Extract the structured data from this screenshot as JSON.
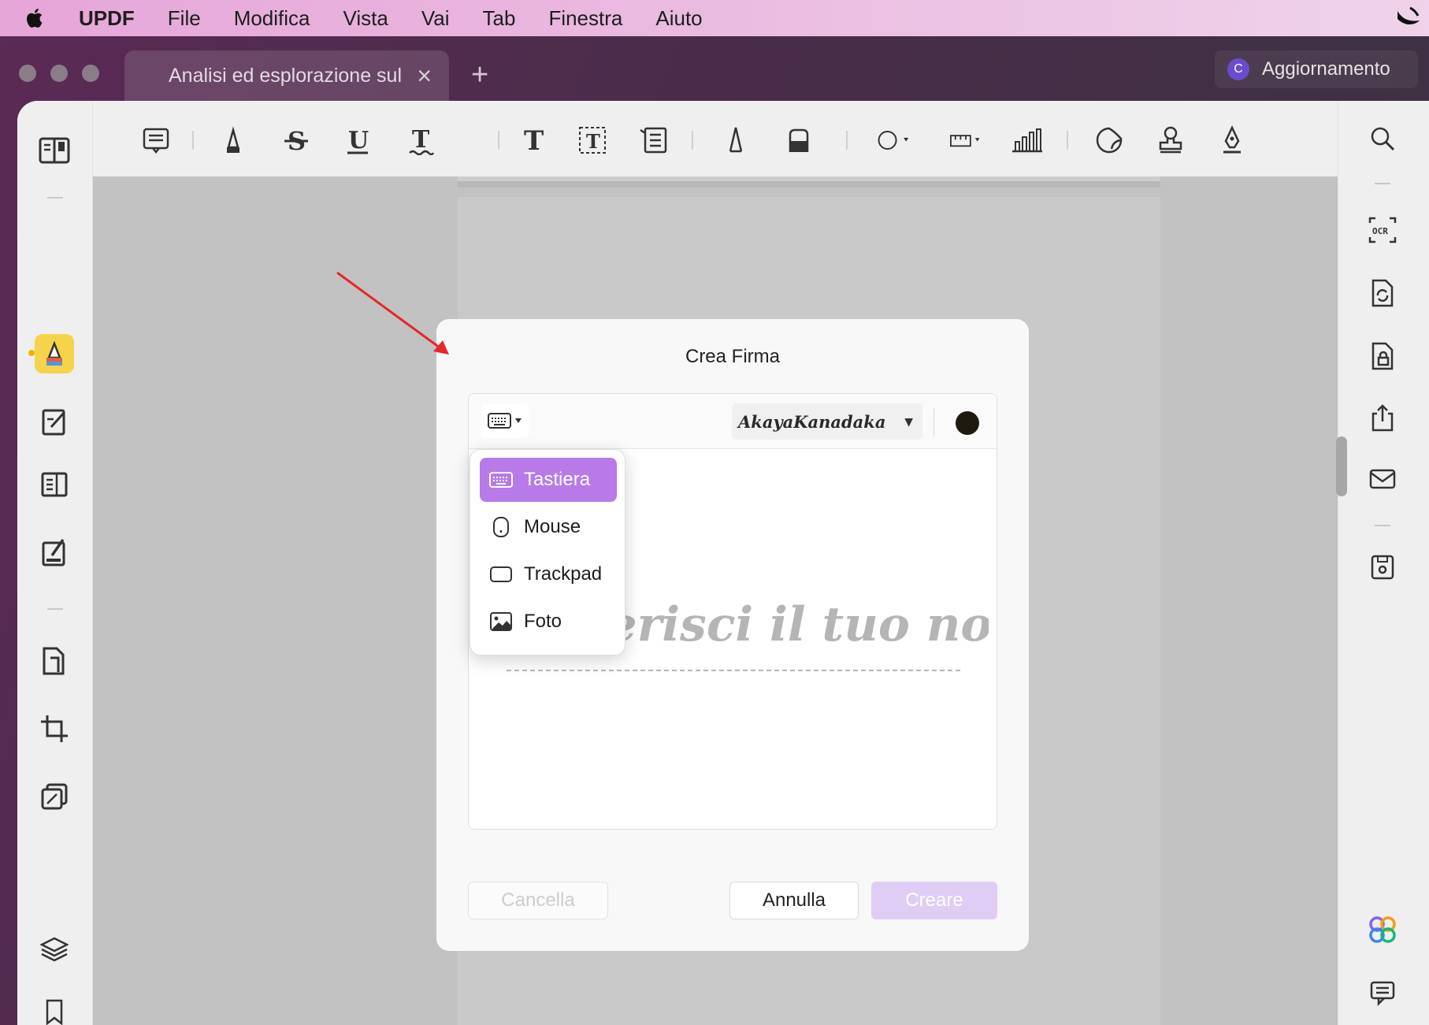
{
  "menubar": {
    "app_name": "UPDF",
    "items": [
      "File",
      "Modifica",
      "Vista",
      "Vai",
      "Tab",
      "Finestra",
      "Aiuto"
    ]
  },
  "window": {
    "tab_title": "Analisi ed esplorazione sul",
    "upgrade_label": "Aggiornamento",
    "avatar_initial": "C"
  },
  "dialog": {
    "title": "Crea Firma",
    "font_name": "AkayaKanadaka",
    "placeholder": "Inserisci il tuo nome",
    "ink_color": "#1e1a10",
    "buttons": {
      "clear": "Cancella",
      "cancel": "Annulla",
      "create": "Creare"
    }
  },
  "input_mode_menu": {
    "selected": "Tastiera",
    "items": [
      {
        "label": "Tastiera",
        "icon": "keyboard-icon"
      },
      {
        "label": "Mouse",
        "icon": "mouse-icon"
      },
      {
        "label": "Trackpad",
        "icon": "trackpad-icon"
      },
      {
        "label": "Foto",
        "icon": "photo-icon"
      }
    ]
  },
  "colors": {
    "accent": "#b77ae8",
    "highlight_tool": "#f5d44b",
    "annotation_arrow": "#e8262b"
  }
}
